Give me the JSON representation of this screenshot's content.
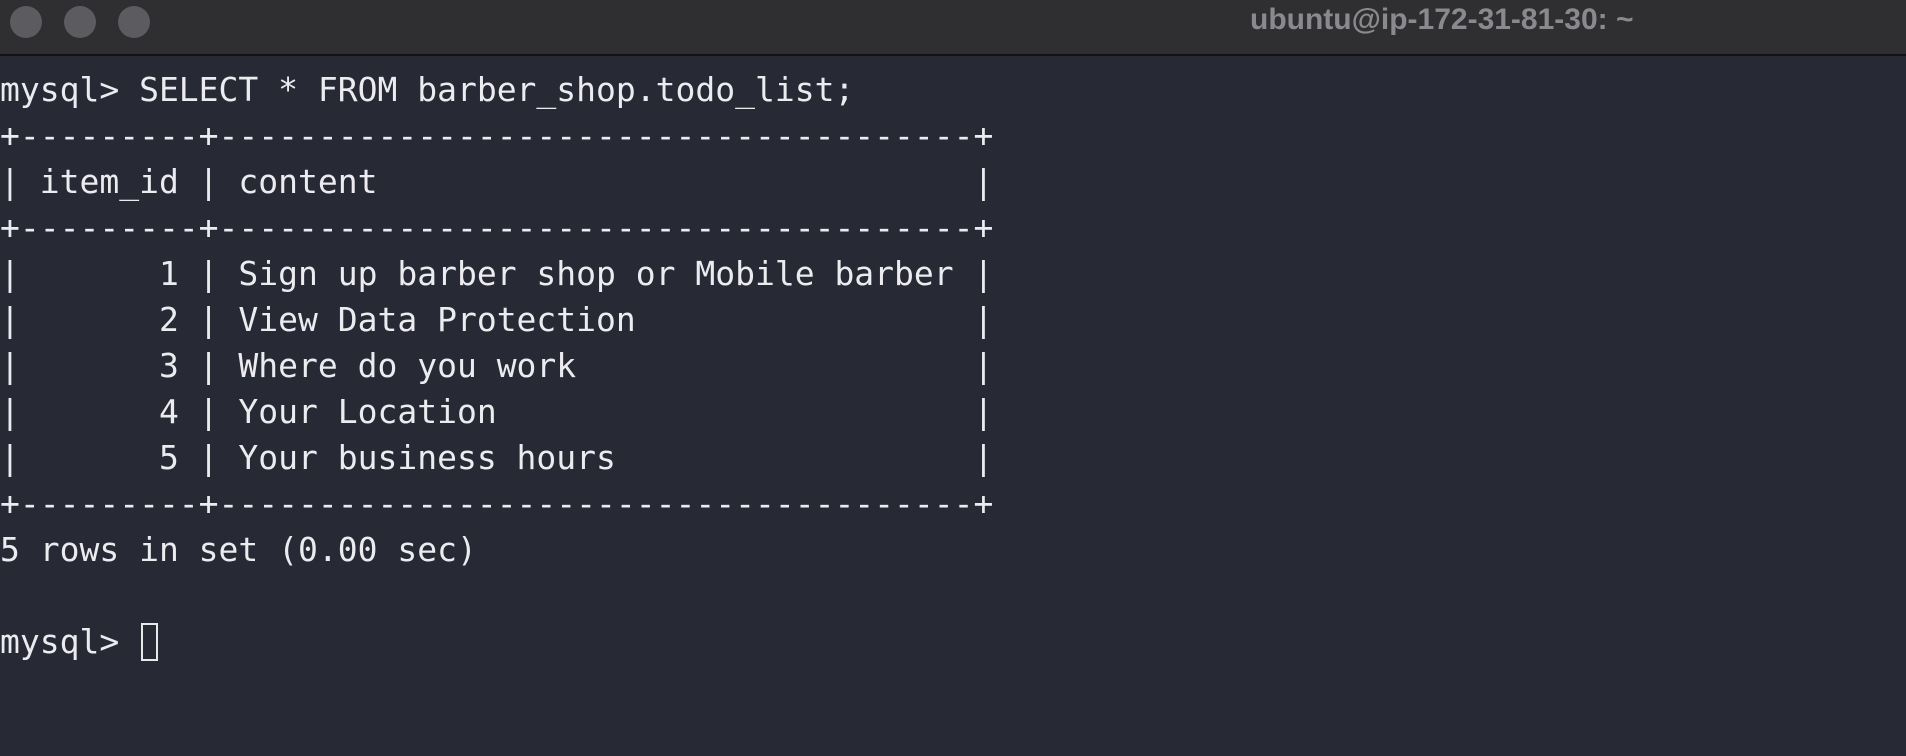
{
  "window": {
    "title": "ubuntu@ip-172-31-81-30: ~"
  },
  "terminal": {
    "command_line": "mysql> SELECT * FROM barber_shop.todo_list;",
    "border_line": "+---------+--------------------------------------+",
    "header_row": "| item_id | content                              |",
    "rows": [
      {
        "item_id": "1",
        "content": "Sign up barber shop or Mobile barber",
        "text": "|       1 | Sign up barber shop or Mobile barber |"
      },
      {
        "item_id": "2",
        "content": "View Data Protection",
        "text": "|       2 | View Data Protection                 |"
      },
      {
        "item_id": "3",
        "content": "Where do you work",
        "text": "|       3 | Where do you work                    |"
      },
      {
        "item_id": "4",
        "content": "Your Location",
        "text": "|       4 | Your Location                        |"
      },
      {
        "item_id": "5",
        "content": "Your business hours",
        "text": "|       5 | Your business hours                  |"
      }
    ],
    "result_summary": "5 rows in set (0.00 sec)",
    "prompt": "mysql> "
  },
  "icons": {
    "close": "traffic-light-close-icon",
    "minimize": "traffic-light-minimize-icon",
    "zoom": "traffic-light-zoom-icon"
  },
  "colors": {
    "background": "#272935",
    "titlebar": "#2f2f31",
    "text": "#ececf0",
    "title_text": "#8a8a8e",
    "traffic_inactive": "#5c5c60"
  }
}
